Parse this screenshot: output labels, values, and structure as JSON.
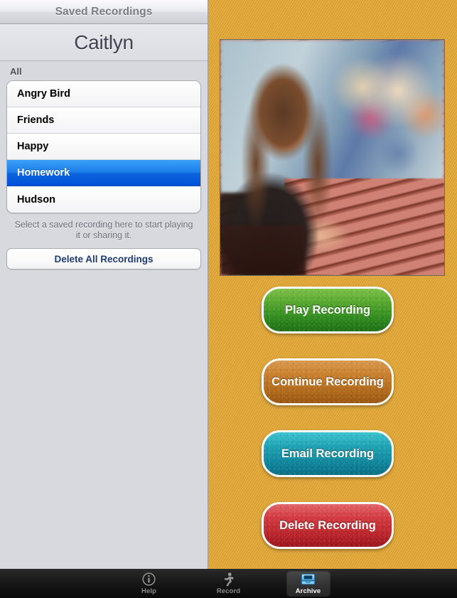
{
  "navbar": {
    "title": "Saved Recordings"
  },
  "sidebar": {
    "person_name": "Caitlyn",
    "section_label": "All",
    "recordings": [
      {
        "label": "Angry Bird",
        "selected": false
      },
      {
        "label": "Friends",
        "selected": false
      },
      {
        "label": "Happy",
        "selected": false
      },
      {
        "label": "Homework",
        "selected": true
      },
      {
        "label": "Hudson",
        "selected": false
      }
    ],
    "hint_text": "Select a saved recording here to start playing it or sharing it.",
    "delete_all_label": "Delete All Recordings"
  },
  "detail": {
    "photo_alt": "Teenage girl writing in notebook at an outdoor picnic table with friends",
    "buttons": [
      {
        "id": "play",
        "label": "Play Recording",
        "color": "#2f8a1f"
      },
      {
        "id": "continue",
        "label": "Continue Recording",
        "color": "#b06a1c"
      },
      {
        "id": "email",
        "label": "Email Recording",
        "color": "#10859b"
      },
      {
        "id": "delete",
        "label": "Delete Recording",
        "color": "#b9242b"
      }
    ]
  },
  "tabbar": {
    "tabs": [
      {
        "label": "Help",
        "icon": "info-circle-icon",
        "selected": false
      },
      {
        "label": "Record",
        "icon": "running-person-icon",
        "selected": false
      },
      {
        "label": "Archive",
        "icon": "archive-tray-icon",
        "selected": true
      }
    ]
  },
  "theme": {
    "accent_orange": "#e4a834",
    "selection_blue": "#0d64dd",
    "sidebar_bg": "#d7d9de",
    "tabbar_bg": "#161616"
  }
}
